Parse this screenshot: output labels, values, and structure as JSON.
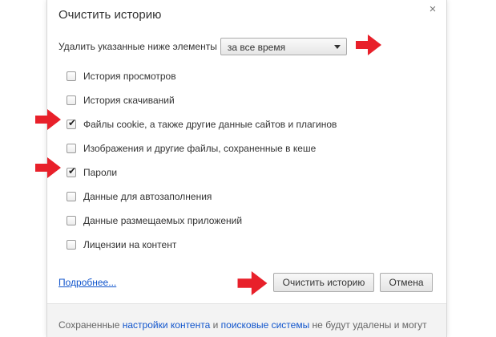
{
  "dialog": {
    "title": "Очистить историю",
    "close_glyph": "×"
  },
  "range": {
    "label": "Удалить указанные ниже элементы",
    "selected": "за все время"
  },
  "options": [
    {
      "label": "История просмотров",
      "checked": false
    },
    {
      "label": "История скачиваний",
      "checked": false
    },
    {
      "label": "Файлы cookie, а также другие данные сайтов и плагинов",
      "checked": true
    },
    {
      "label": "Изображения и другие файлы, сохраненные в кеше",
      "checked": false
    },
    {
      "label": "Пароли",
      "checked": true
    },
    {
      "label": "Данные для автозаполнения",
      "checked": false
    },
    {
      "label": "Данные размещаемых приложений",
      "checked": false
    },
    {
      "label": "Лицензии на контент",
      "checked": false
    }
  ],
  "actions": {
    "more_link": "Подробнее...",
    "clear_button": "Очистить историю",
    "cancel_button": "Отмена"
  },
  "footer": {
    "text_before": "Сохраненные ",
    "link_content_settings": "настройки контента",
    "text_and": " и ",
    "link_search_engines": "поисковые системы",
    "text_after": " не будут удалены и могут"
  },
  "colors": {
    "annotation_arrow": "#e8202a",
    "link": "#1155cc",
    "footer_bg": "#f3f3f3"
  },
  "icons": {
    "close": "close-icon",
    "dropdown": "chevron-down-icon",
    "checkmark": "checkmark-icon",
    "annotation": "arrow-right-icon"
  }
}
